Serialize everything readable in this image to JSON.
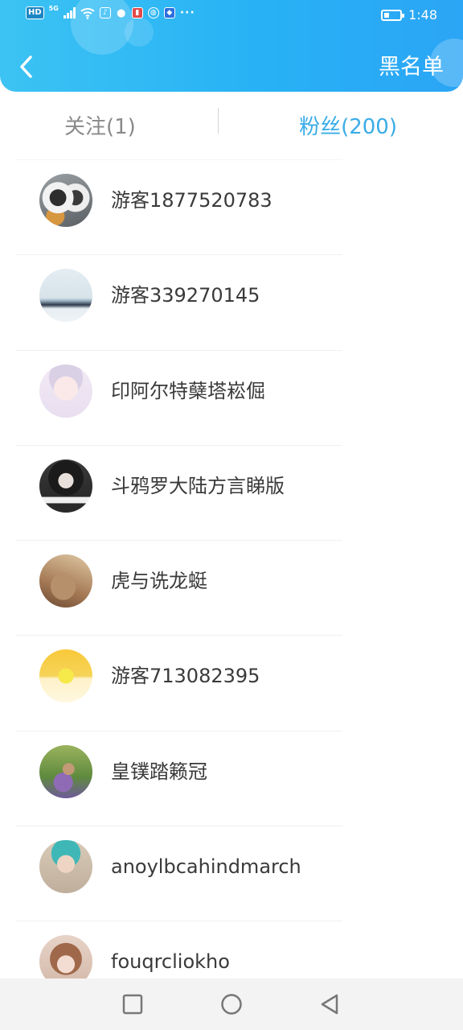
{
  "status_bar": {
    "network_badge": "HD",
    "signal_label": "5G",
    "time": "1:48",
    "battery_level": 0.35,
    "overflow": "···",
    "notification_icons": [
      "music-icon",
      "wechat-icon",
      "notes-icon",
      "browser-icon",
      "app-icon"
    ]
  },
  "header": {
    "back_icon": "chevron-left-icon",
    "right_action": "黑名单",
    "gradient_start": "#3cc3f3",
    "gradient_end": "#2ba5f5"
  },
  "tabs": {
    "following": "关注(1)",
    "fans": "粉丝(200)",
    "active": "fans",
    "active_color": "#3aace7",
    "inactive_color": "#8a8a8a"
  },
  "fans": [
    {
      "name": "游客1877520783"
    },
    {
      "name": "游客339270145"
    },
    {
      "name": "印阿尔特蘖塔崧倔"
    },
    {
      "name": "斗鸦罗大陆方言睇版"
    },
    {
      "name": "虎与诜龙蜓"
    },
    {
      "name": "游客713082395"
    },
    {
      "name": "皇镤踏籁冠"
    },
    {
      "name": "anoylbcahindmarch"
    },
    {
      "name": "fouqrcliokho"
    }
  ],
  "nav_bar": {
    "recents_icon": "square-icon",
    "home_icon": "circle-icon",
    "back_icon": "triangle-back-icon"
  }
}
